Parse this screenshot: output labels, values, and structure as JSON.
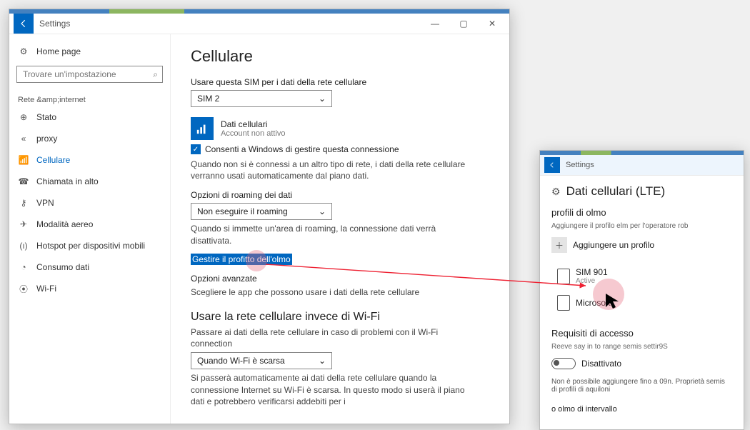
{
  "win1": {
    "title": "Settings",
    "sidebar": {
      "home": "Home page",
      "search_placeholder": "Trovare un'impostazione",
      "group": "Rete &amp;internet",
      "items": [
        {
          "icon": "⊕",
          "label": "Stato"
        },
        {
          "icon": "«",
          "label": "proxy"
        },
        {
          "icon": "📶",
          "label": "Cellulare"
        },
        {
          "icon": "☎",
          "label": "Chiamata in alto"
        },
        {
          "icon": "⚷",
          "label": "VPN"
        },
        {
          "icon": "✈",
          "label": "Modalità aereo"
        },
        {
          "icon": "(ı)",
          "label": "Hotspot per dispositivi mobili"
        },
        {
          "icon": "◔",
          "label": "Consumo dati"
        },
        {
          "icon": "⦿",
          "label": "Wi-Fi"
        }
      ]
    },
    "main": {
      "title": "Cellulare",
      "sim_label": "Usare questa SIM per i dati della rete cellulare",
      "sim_value": "SIM 2",
      "data_tile": {
        "title": "Dati cellulari",
        "sub": "Account non attivo"
      },
      "allow": "Consenti a Windows di gestire questa connessione",
      "allow_text": "Quando non si è connessi a un altro tipo di rete, i dati della rete cellulare verranno usati automaticamente dal piano dati.",
      "roam_label": "Opzioni di roaming dei dati",
      "roam_value": "Non eseguire il roaming",
      "roam_text": "Quando si immette un'area di roaming, la connessione dati verrà disattivata.",
      "manage_link": "Gestire il profitto dell'olmo",
      "advanced": "Opzioni avanzate",
      "apps_text": "Scegliere le app che possono usare i dati della rete cellulare",
      "wifi_title": "Usare la rete cellulare invece di Wi-Fi",
      "wifi_desc": "Passare ai dati della rete cellulare in caso di problemi con il Wi-Fi connection",
      "wifi_value": "Quando Wi-Fi è scarsa",
      "wifi_text": "Si passerà automaticamente ai dati della rete cellulare quando la connessione Internet su Wi-Fi è scarsa. In questo modo si userà il piano dati e potrebbero verificarsi addebiti per i"
    }
  },
  "win2": {
    "title": "Settings",
    "page_title": "Dati cellulari (LTE)",
    "profiles_label": "profili di olmo",
    "profiles_sub": "Aggiungere il profilo elm per l'operatore rob",
    "add_label": "Aggiungere un profilo",
    "sims": [
      {
        "name": "SIM 901",
        "sub": "Active"
      },
      {
        "name": "Microsoft",
        "sub": ""
      }
    ],
    "req_title": "Requisiti di accesso",
    "req_sub": "Reeve say in to range semis settir9S",
    "toggle_label": "Disattivato",
    "req_text": "Non è possibile aggiungere fino a 09n. Proprietà semis di profili di aquiloni",
    "footer": "o olmo di intervallo"
  }
}
